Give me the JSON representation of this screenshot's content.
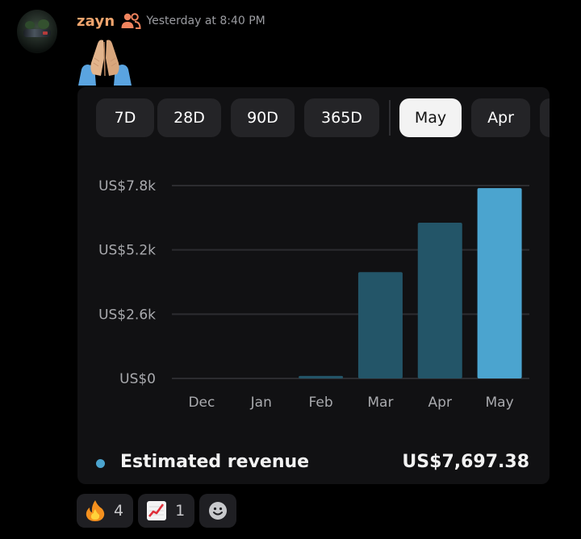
{
  "message": {
    "username": "zayn",
    "timestamp": "Yesterday at 8:40 PM",
    "username_color": "#f0a56e",
    "content_emoji": "pray-emoji"
  },
  "tabs": [
    {
      "label": "7D",
      "active": false
    },
    {
      "label": "28D",
      "active": false
    },
    {
      "label": "90D",
      "active": false
    },
    {
      "label": "365D",
      "active": false
    },
    {
      "label": "May",
      "active": true
    },
    {
      "label": "Apr",
      "active": false
    }
  ],
  "chart_data": {
    "type": "bar",
    "categories": [
      "Dec",
      "Jan",
      "Feb",
      "Mar",
      "Apr",
      "May"
    ],
    "values": [
      0,
      0,
      100,
      4300,
      6300,
      7697.38
    ],
    "y_ticks": [
      {
        "value": 0,
        "label": "US$0"
      },
      {
        "value": 2600,
        "label": "US$2.6k"
      },
      {
        "value": 5200,
        "label": "US$5.2k"
      },
      {
        "value": 7800,
        "label": "US$7.8k"
      }
    ],
    "ylim": [
      0,
      7800
    ],
    "grid": true,
    "colors": {
      "highlight": "#4ba4cf",
      "dim": "#235568",
      "grid": "#2c2c30",
      "tick": "#a9aaae"
    },
    "highlight_index": 5
  },
  "legend": {
    "label": "Estimated revenue",
    "value": "US$7,697.38",
    "color": "#4ba4cf"
  },
  "reactions": [
    {
      "icon": "fire-emoji",
      "count": "4"
    },
    {
      "icon": "chart-increasing-emoji",
      "count": "1"
    }
  ],
  "add_reaction_icon": "smiley-add-reaction-icon"
}
